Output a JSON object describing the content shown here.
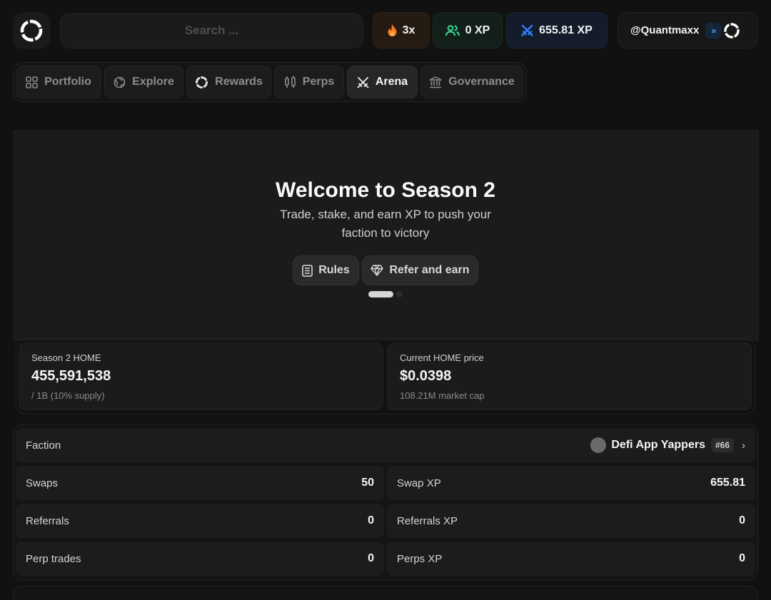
{
  "header": {
    "search_placeholder": "Search ...",
    "streak": {
      "value": "3x",
      "icon": "flame-icon"
    },
    "referral_xp": {
      "value": "0 XP",
      "icon": "users-icon"
    },
    "arena_xp": {
      "value": "655.81 XP",
      "icon": "swords-icon"
    },
    "user": {
      "handle": "@Quantmaxx",
      "badge_icon": "double-chevron-icon"
    }
  },
  "nav": {
    "items": [
      {
        "label": "Portfolio",
        "icon": "grid-icon"
      },
      {
        "label": "Explore",
        "icon": "globe-icon"
      },
      {
        "label": "Rewards",
        "icon": "ring-icon"
      },
      {
        "label": "Perps",
        "icon": "candles-icon"
      },
      {
        "label": "Arena",
        "icon": "swords-icon",
        "active": true
      },
      {
        "label": "Governance",
        "icon": "bank-icon"
      }
    ]
  },
  "hero": {
    "title": "Welcome to Season 2",
    "subtitle": "Trade, stake, and earn XP to push your faction to victory",
    "rules_label": "Rules",
    "refer_label": "Refer and earn"
  },
  "stats_cards": [
    {
      "label": "Season 2 HOME",
      "value": "455,591,538",
      "sub": "/ 1B (10% supply)"
    },
    {
      "label": "Current HOME price",
      "value": "$0.0398",
      "sub": "108.21M market cap"
    }
  ],
  "faction": {
    "label": "Faction",
    "name": "Defi App Yappers",
    "rank": "#66"
  },
  "stats_rows": [
    {
      "label": "Swaps",
      "value": "50",
      "xp_label": "Swap XP",
      "xp_value": "655.81"
    },
    {
      "label": "Referrals",
      "value": "0",
      "xp_label": "Referrals XP",
      "xp_value": "0"
    },
    {
      "label": "Perp trades",
      "value": "0",
      "xp_label": "Perps XP",
      "xp_value": "0"
    }
  ],
  "colors": {
    "background": "#111111",
    "panel": "#1b1b1b",
    "arena_accent": "#2d7ff9",
    "xp_accent": "#3ddc97",
    "streak_accent": "#ff7a1a"
  }
}
